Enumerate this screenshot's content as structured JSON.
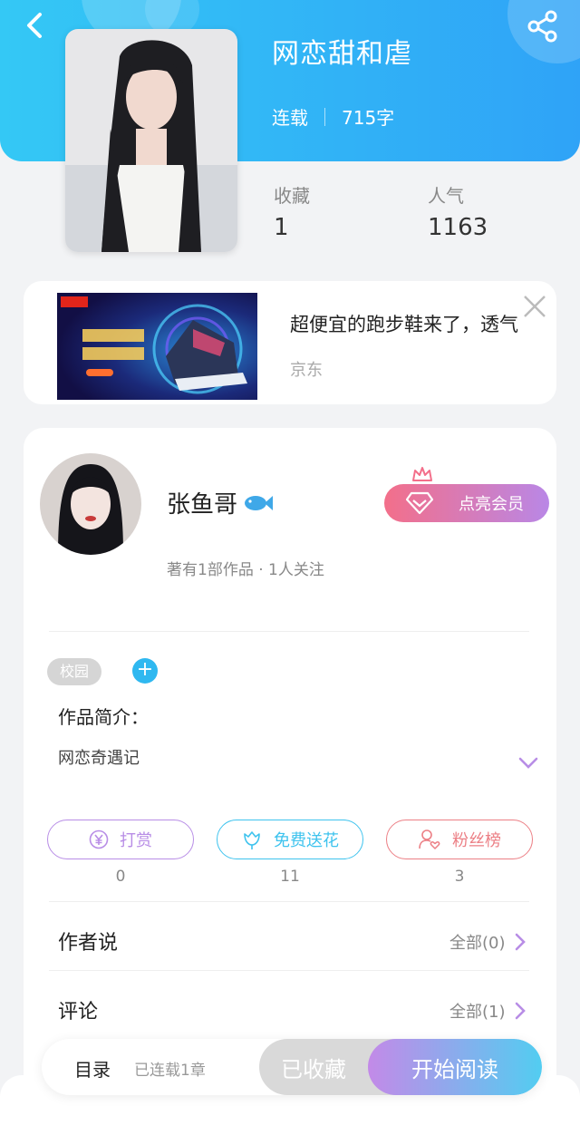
{
  "book": {
    "title": "网恋甜和虐",
    "status": "连载",
    "word_count": "715字",
    "stats": [
      {
        "label": "收藏",
        "value": "1"
      },
      {
        "label": "人气",
        "value": "1163"
      }
    ]
  },
  "ad": {
    "title": "超便宜的跑步鞋来了，透气",
    "source": "京东"
  },
  "author": {
    "name": "张鱼哥",
    "stats": "著有1部作品 · 1人关注",
    "vip_label": "点亮会员"
  },
  "tags": [
    "校园"
  ],
  "tag_add_label": "+",
  "intro": {
    "label": "作品简介：",
    "text": "网恋奇遇记"
  },
  "actions": [
    {
      "label": "打赏",
      "count": "0",
      "color": "#b88de6"
    },
    {
      "label": "免费送花",
      "count": "11",
      "color": "#3ec3ee"
    },
    {
      "label": "粉丝榜",
      "count": "3",
      "color": "#ec7f85"
    }
  ],
  "rows": [
    {
      "label": "作者说",
      "more": "全部(0)"
    },
    {
      "label": "评论",
      "more": "全部(1)"
    }
  ],
  "bottom": {
    "toc_label": "目录",
    "chapter_count": "已连载1章",
    "fav_label": "已收藏",
    "read_label": "开始阅读"
  },
  "colors": {
    "header_start": "#34c8f5",
    "header_end": "#2fa3f7",
    "accent_blue": "#2fb8f0"
  }
}
